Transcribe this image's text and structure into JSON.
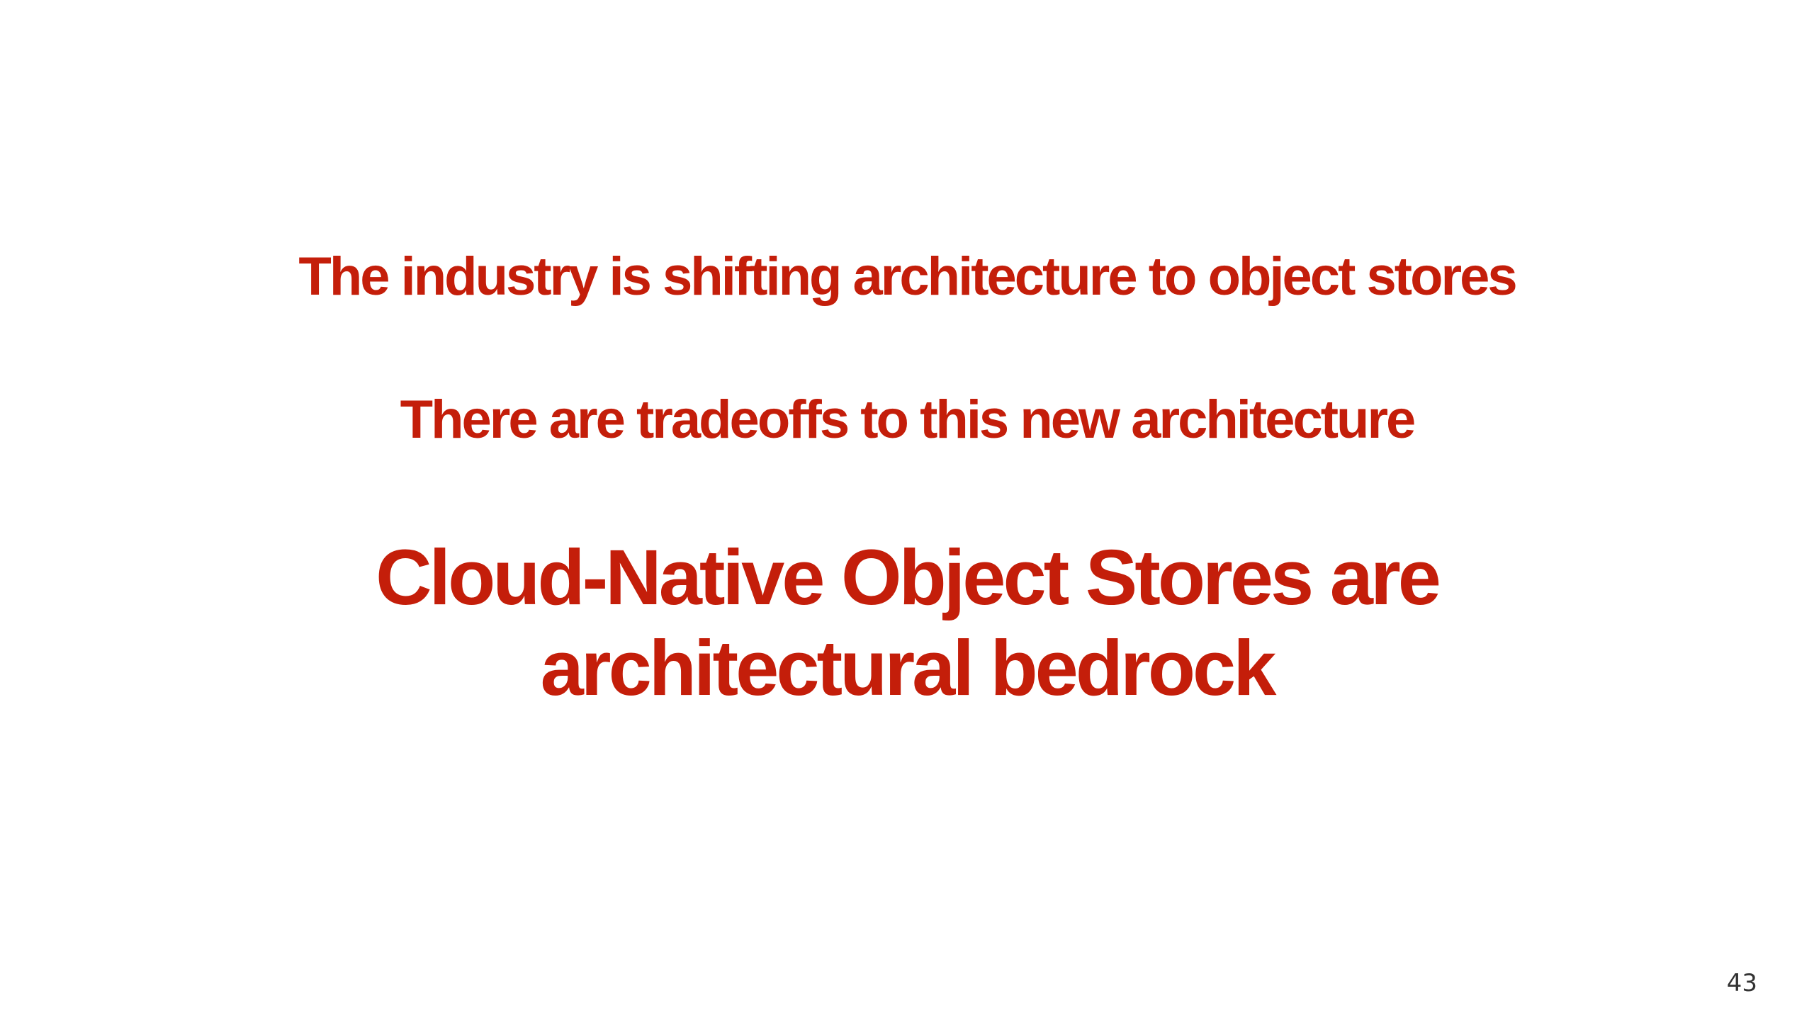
{
  "slide": {
    "line1": "The industry is shifting architecture to object stores",
    "line2": "There are tradeoffs to this new architecture",
    "headline": [
      "Cloud-Native Object Stores are",
      "architectural bedrock"
    ],
    "page_number": "43"
  },
  "colors": {
    "text_accent": "#c41e0a",
    "background": "#ffffff",
    "page_number": "#333333"
  }
}
